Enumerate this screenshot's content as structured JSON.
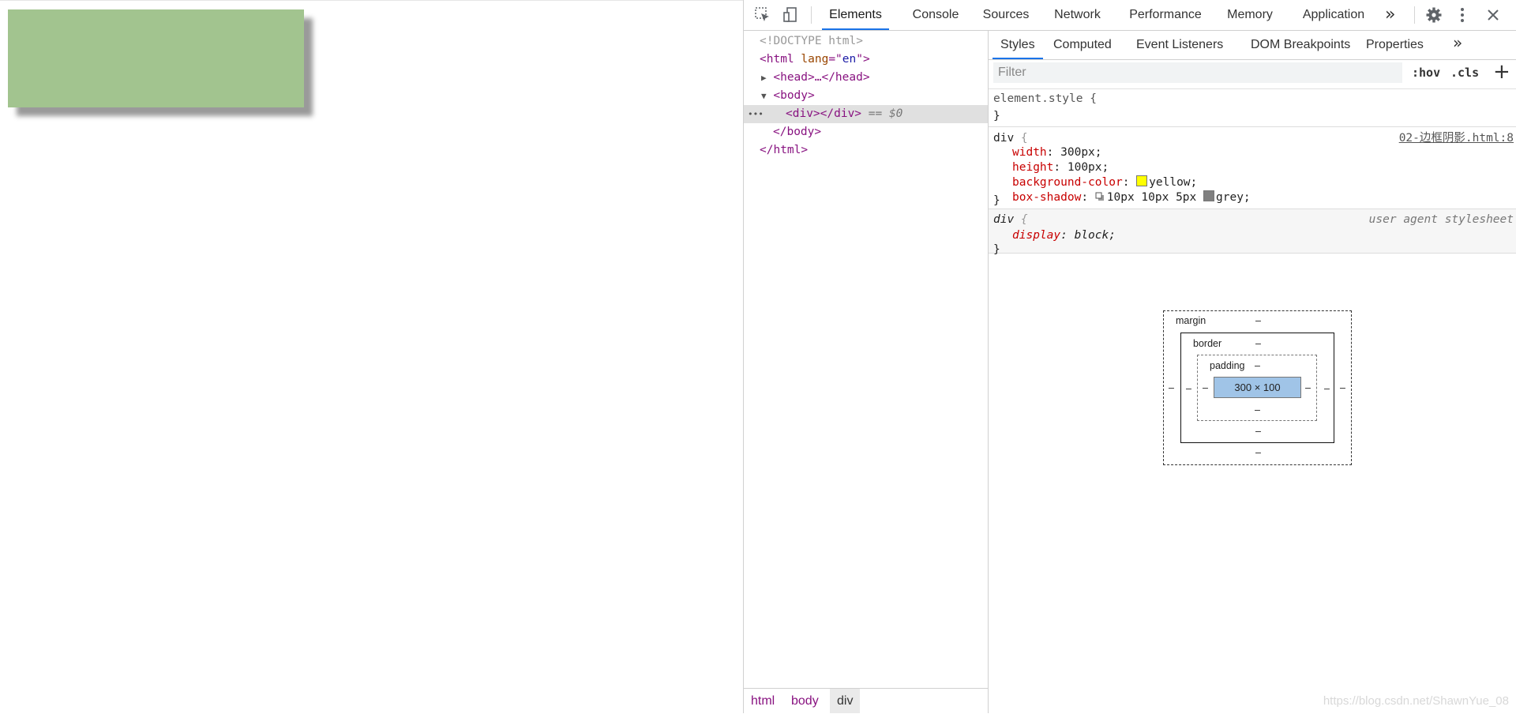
{
  "devtools": {
    "main_tabs": [
      {
        "label": "Elements",
        "active": true
      },
      {
        "label": "Console"
      },
      {
        "label": "Sources"
      },
      {
        "label": "Network"
      },
      {
        "label": "Performance"
      },
      {
        "label": "Memory"
      },
      {
        "label": "Application"
      }
    ],
    "more_tabs": "»",
    "dom_tree": {
      "doctype": "<!DOCTYPE html>",
      "html_open_tag": "<html",
      "html_attr_name": "lang",
      "html_attr_eq": "=\"",
      "html_attr_value": "en",
      "html_attr_close": "\">",
      "head_line": "<head>…</head>",
      "body_open": "<body>",
      "selected_ellipsis": "•••",
      "div_line": "<div></div>",
      "selected_suffix": "== $0",
      "body_close": "</body>",
      "html_close": "</html>"
    },
    "breadcrumbs": [
      "html",
      "body",
      "div"
    ],
    "styles_tabs": [
      {
        "label": "Styles",
        "active": true
      },
      {
        "label": "Computed"
      },
      {
        "label": "Event Listeners"
      },
      {
        "label": "DOM Breakpoints"
      },
      {
        "label": "Properties"
      }
    ],
    "filter": {
      "placeholder": "Filter",
      "hov": ":hov",
      "cls": ".cls",
      "plus": "+"
    },
    "rules": {
      "element_style": {
        "selector": "element.style {",
        "close": "}"
      },
      "div_rule": {
        "selector": "div",
        "open": " {",
        "source": "02-边框阴影.html:8",
        "declarations": [
          {
            "prop": "width",
            "value": "300px;"
          },
          {
            "prop": "height",
            "value": "100px;"
          },
          {
            "prop": "background-color",
            "value": "yellow;",
            "swatch": "#ffff00"
          },
          {
            "prop": "box-shadow",
            "value": "10px 10px 5px ",
            "value2": "grey;",
            "swatch": "#808080"
          }
        ],
        "close": "}"
      },
      "ua_rule": {
        "selector": "div",
        "open": " {",
        "source": "user agent stylesheet",
        "prop": "display",
        "value": "block;",
        "close": "}"
      }
    },
    "box_model": {
      "margin_label": "margin",
      "border_label": "border",
      "padding_label": "padding",
      "content_size": "300 × 100",
      "dash": "–"
    }
  },
  "watermark": "https://blog.csdn.net/ShawnYue_08",
  "colors": {
    "demo_box": "#a2c48f",
    "accent": "#1a73e8"
  }
}
